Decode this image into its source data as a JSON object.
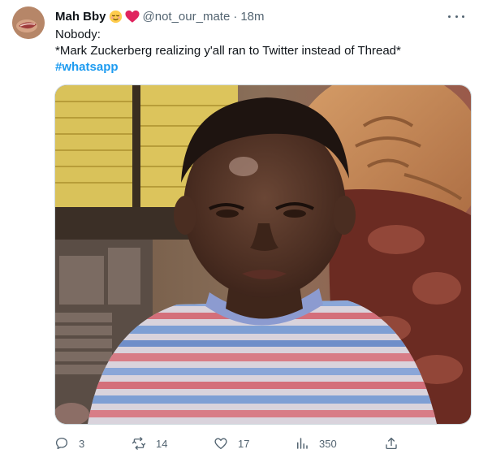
{
  "tweet": {
    "author_name": "Mah Bby",
    "author_emojis": [
      "relieved-face-emoji",
      "red-heart-emoji"
    ],
    "handle": "@not_our_mate",
    "separator": "·",
    "time": "18m",
    "lines": [
      "Nobody:",
      "*Mark Zuckerberg realizing y'all ran to Twitter instead of Thread*"
    ],
    "hashtag": "#whatsapp",
    "media_alt": "Meme photo of a boy in a striped shirt looking puzzled",
    "colors": {
      "accent": "#1d9bf0",
      "muted": "#536471",
      "text": "#0f1419"
    },
    "actions": {
      "reply": {
        "icon": "reply-icon",
        "count": "3"
      },
      "retweet": {
        "icon": "retweet-icon",
        "count": "14"
      },
      "like": {
        "icon": "like-icon",
        "count": "17"
      },
      "views": {
        "icon": "views-icon",
        "count": "350"
      },
      "share": {
        "icon": "share-icon"
      }
    }
  }
}
